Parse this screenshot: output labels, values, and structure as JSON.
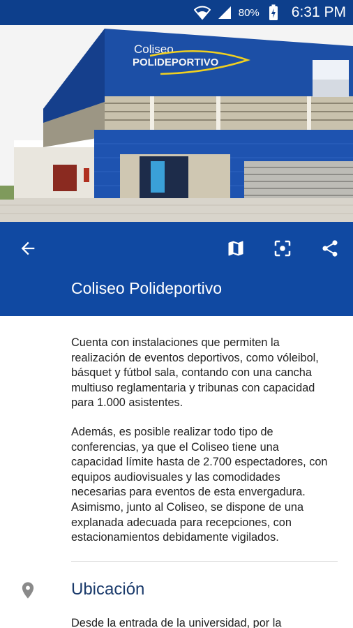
{
  "status_bar": {
    "wifi_icon": "wifi-icon",
    "signal_icon": "signal-icon",
    "battery": "80%",
    "battery_icon": "battery-charging-icon",
    "time": "6:31 PM",
    "color": "#0d3f8c"
  },
  "hero": {
    "sign_line1": "Coliseo",
    "sign_line2": "POLIDEPORTIVO"
  },
  "app_bar": {
    "back_icon": "arrow-left-icon",
    "map_icon": "map-icon",
    "focus_icon": "center-focus-icon",
    "share_icon": "share-icon",
    "title": "Coliseo Polideportivo",
    "color": "#1049a2"
  },
  "content": {
    "paragraph1": "Cuenta con instalaciones que permiten la realización de eventos deportivos, como vóleibol, básquet y fútbol sala, contando con una cancha multiuso reglamentaria y tribunas con capacidad para 1.000 asistentes.",
    "paragraph2": "Además, es posible realizar todo tipo de conferencias, ya que el Coliseo tiene una capacidad límite hasta de 2.700 espectadores, con equipos audiovisuales y las comodidades necesarias para eventos de esta envergadura. Asimismo, junto al Coliseo, se dispone de una explanada adecuada para recepciones, con estacionamientos debidamente vigilados.",
    "location_icon": "location-pin-icon",
    "location_title": "Ubicación",
    "location_text": "Desde la entrada de la universidad, por la"
  }
}
